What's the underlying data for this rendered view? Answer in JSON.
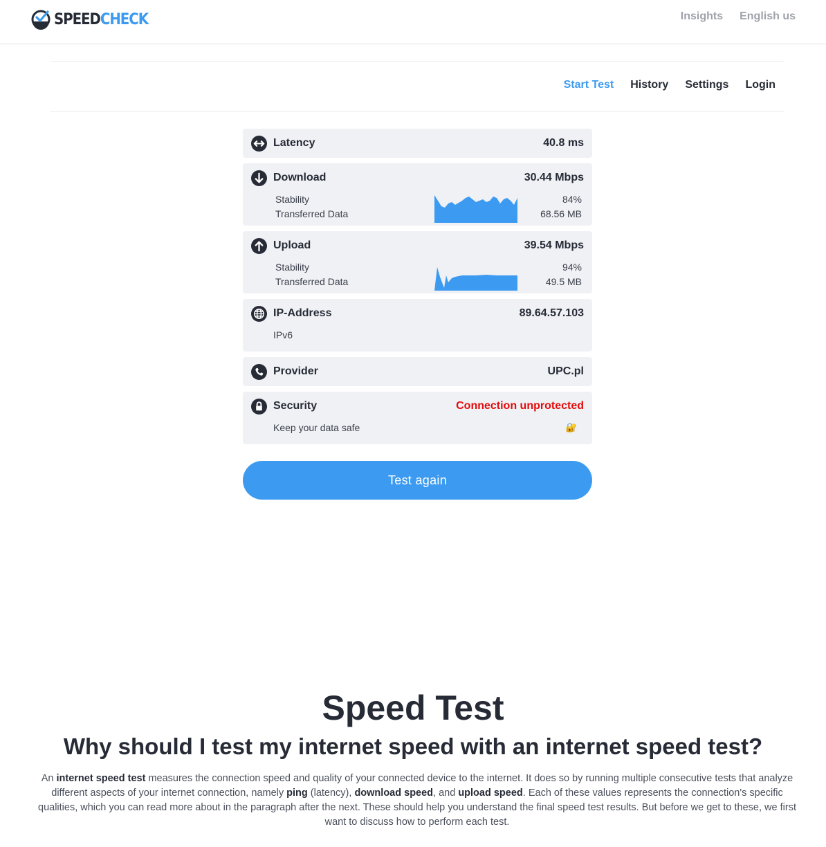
{
  "header": {
    "logo_part1": "SPEED",
    "logo_part2": "CHECK",
    "links": [
      "Insights",
      "English us"
    ]
  },
  "nav": {
    "items": [
      "Start Test",
      "History",
      "Settings",
      "Login"
    ],
    "active": "Start Test"
  },
  "results": {
    "latency": {
      "label": "Latency",
      "value": "40.8 ms",
      "icon": "arrows-horizontal-icon"
    },
    "download": {
      "label": "Download",
      "value": "30.44 Mbps",
      "icon": "arrow-down-circle-icon",
      "stability_label": "Stability",
      "stability_value": "84%",
      "transferred_label": "Transferred Data",
      "transferred_value": "68.56 MB"
    },
    "upload": {
      "label": "Upload",
      "value": "39.54 Mbps",
      "icon": "arrow-up-circle-icon",
      "stability_label": "Stability",
      "stability_value": "94%",
      "transferred_label": "Transferred Data",
      "transferred_value": "49.5 MB"
    },
    "ip": {
      "label": "IP-Address",
      "value": "89.64.57.103",
      "sub": "IPv6",
      "icon": "globe-icon"
    },
    "provider": {
      "label": "Provider",
      "value": "UPC.pl",
      "icon": "phone-icon"
    },
    "security": {
      "label": "Security",
      "value": "Connection unprotected",
      "sub": "Keep your data safe",
      "badge": "🔐",
      "icon": "lock-icon"
    }
  },
  "button": {
    "label": "Test again"
  },
  "article": {
    "title": "Speed Test",
    "subtitle": "Why should I test my internet speed with an internet speed test?",
    "p_1": "An ",
    "p_2": "internet speed test",
    "p_3": " measures the connection speed and quality of your connected device to the internet. It does so by running multiple consecutive tests that analyze different aspects of your internet connection, namely ",
    "p_4": "ping",
    "p_5": " (latency), ",
    "p_6": "download speed",
    "p_7": ", and ",
    "p_8": "upload speed",
    "p_9": ". Each of these values represents the connection's specific qualities, which you can read more about in the paragraph after the next. These should help you understand the final speed test results. But before we get to these, we first want to discuss how to perform each test."
  },
  "colors": {
    "accent": "#3c9bf0",
    "danger": "#e30b0b",
    "card": "#f0f1f5",
    "text": "#262b36"
  }
}
